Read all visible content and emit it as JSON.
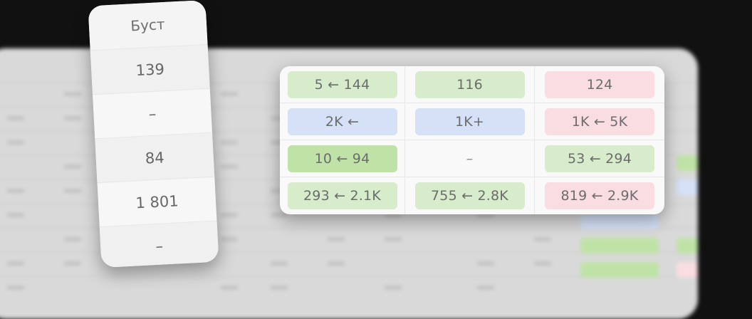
{
  "boost_column": {
    "header": "Буст",
    "values": [
      "139",
      "–",
      "84",
      "1 801",
      "–"
    ]
  },
  "change_table": {
    "rows": [
      [
        {
          "text": "5 ← 144",
          "tone": "green"
        },
        {
          "text": "116",
          "tone": "green"
        },
        {
          "text": "124",
          "tone": "red"
        }
      ],
      [
        {
          "text": "2K ←",
          "tone": "blue"
        },
        {
          "text": "1K+",
          "tone": "blue"
        },
        {
          "text": "1K ← 5K",
          "tone": "red"
        }
      ],
      [
        {
          "text": "10 ← 94",
          "tone": "green-strong"
        },
        {
          "text": "–",
          "tone": "none"
        },
        {
          "text": "53 ← 294",
          "tone": "green"
        }
      ],
      [
        {
          "text": "293 ← 2.1K",
          "tone": "green"
        },
        {
          "text": "755 ← 2.8K",
          "tone": "green"
        },
        {
          "text": "819 ← 2.9K",
          "tone": "red"
        }
      ]
    ]
  },
  "colors": {
    "green": "#d6eccb",
    "green-strong": "#bfe3a6",
    "blue": "#d4e1f7",
    "red": "#f9dde1"
  }
}
